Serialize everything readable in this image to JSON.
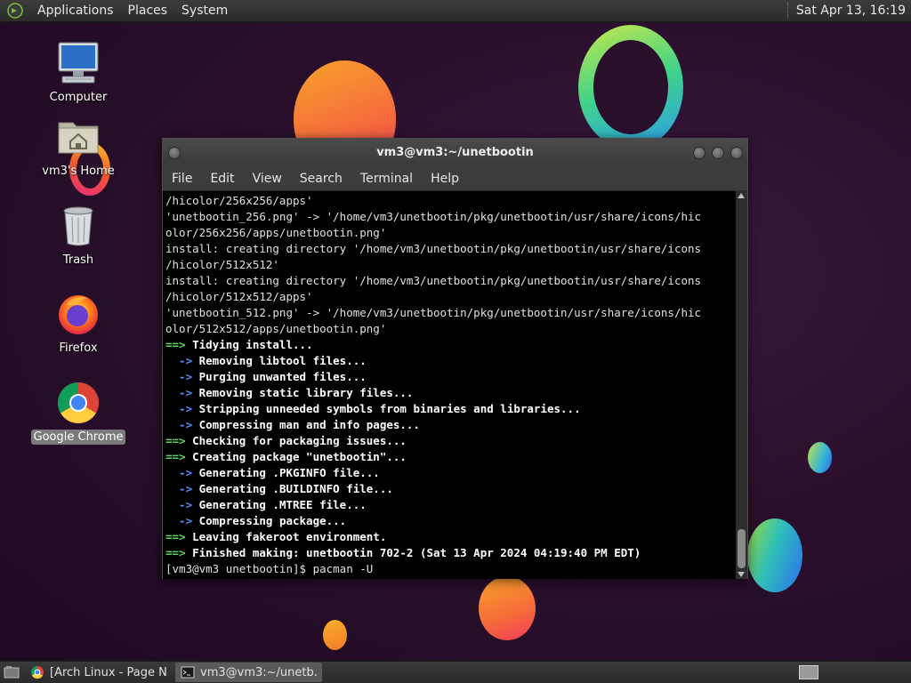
{
  "top_panel": {
    "menus": [
      "Applications",
      "Places",
      "System"
    ],
    "clock": "Sat Apr 13, 16:19"
  },
  "desktop_icons": [
    {
      "label": "Computer",
      "icon": "computer-icon"
    },
    {
      "label": "vm3's Home",
      "icon": "home-folder-icon"
    },
    {
      "label": "Trash",
      "icon": "trash-icon"
    },
    {
      "label": "Firefox",
      "icon": "firefox-icon"
    },
    {
      "label": "Google Chrome",
      "icon": "chrome-icon",
      "selected": true
    }
  ],
  "terminal": {
    "title": "vm3@vm3:~/unetbootin",
    "menu": [
      "File",
      "Edit",
      "View",
      "Search",
      "Terminal",
      "Help"
    ],
    "lines": [
      {
        "t": "plain",
        "text": "/hicolor/256x256/apps'"
      },
      {
        "t": "plain",
        "text": "'unetbootin_256.png' -> '/home/vm3/unetbootin/pkg/unetbootin/usr/share/icons/hic"
      },
      {
        "t": "plain",
        "text": "olor/256x256/apps/unetbootin.png'"
      },
      {
        "t": "plain",
        "text": "install: creating directory '/home/vm3/unetbootin/pkg/unetbootin/usr/share/icons"
      },
      {
        "t": "plain",
        "text": "/hicolor/512x512'"
      },
      {
        "t": "plain",
        "text": "install: creating directory '/home/vm3/unetbootin/pkg/unetbootin/usr/share/icons"
      },
      {
        "t": "plain",
        "text": "/hicolor/512x512/apps'"
      },
      {
        "t": "plain",
        "text": "'unetbootin_512.png' -> '/home/vm3/unetbootin/pkg/unetbootin/usr/share/icons/hic"
      },
      {
        "t": "plain",
        "text": "olor/512x512/apps/unetbootin.png'"
      },
      {
        "t": "main",
        "prefix": "==>",
        "text": " Tidying install..."
      },
      {
        "t": "sub",
        "prefix": "  ->",
        "text": " Removing libtool files..."
      },
      {
        "t": "sub",
        "prefix": "  ->",
        "text": " Purging unwanted files..."
      },
      {
        "t": "sub",
        "prefix": "  ->",
        "text": " Removing static library files..."
      },
      {
        "t": "sub",
        "prefix": "  ->",
        "text": " Stripping unneeded symbols from binaries and libraries..."
      },
      {
        "t": "sub",
        "prefix": "  ->",
        "text": " Compressing man and info pages..."
      },
      {
        "t": "main",
        "prefix": "==>",
        "text": " Checking for packaging issues..."
      },
      {
        "t": "main",
        "prefix": "==>",
        "text": " Creating package \"unetbootin\"..."
      },
      {
        "t": "sub",
        "prefix": "  ->",
        "text": " Generating .PKGINFO file..."
      },
      {
        "t": "sub",
        "prefix": "  ->",
        "text": " Generating .BUILDINFO file..."
      },
      {
        "t": "sub",
        "prefix": "  ->",
        "text": " Generating .MTREE file..."
      },
      {
        "t": "sub",
        "prefix": "  ->",
        "text": " Compressing package..."
      },
      {
        "t": "main",
        "prefix": "==>",
        "text": " Leaving fakeroot environment."
      },
      {
        "t": "main",
        "prefix": "==>",
        "text": " Finished making: unetbootin 702-2 (Sat 13 Apr 2024 04:19:40 PM EDT)"
      },
      {
        "t": "plain",
        "text": "[vm3@vm3 unetbootin]$ pacman -U"
      }
    ]
  },
  "taskbar": {
    "tasks": [
      {
        "label": "[Arch Linux - Page N...",
        "icon": "chrome-icon",
        "active": false
      },
      {
        "label": "vm3@vm3:~/unetb...",
        "icon": "terminal-icon",
        "active": true
      }
    ]
  },
  "colors": {
    "prompt_arrow": "#5fd35f",
    "sub_arrow": "#5a8cff",
    "terminal_bg": "#000000",
    "panel_bg": "#2e2e2e"
  }
}
